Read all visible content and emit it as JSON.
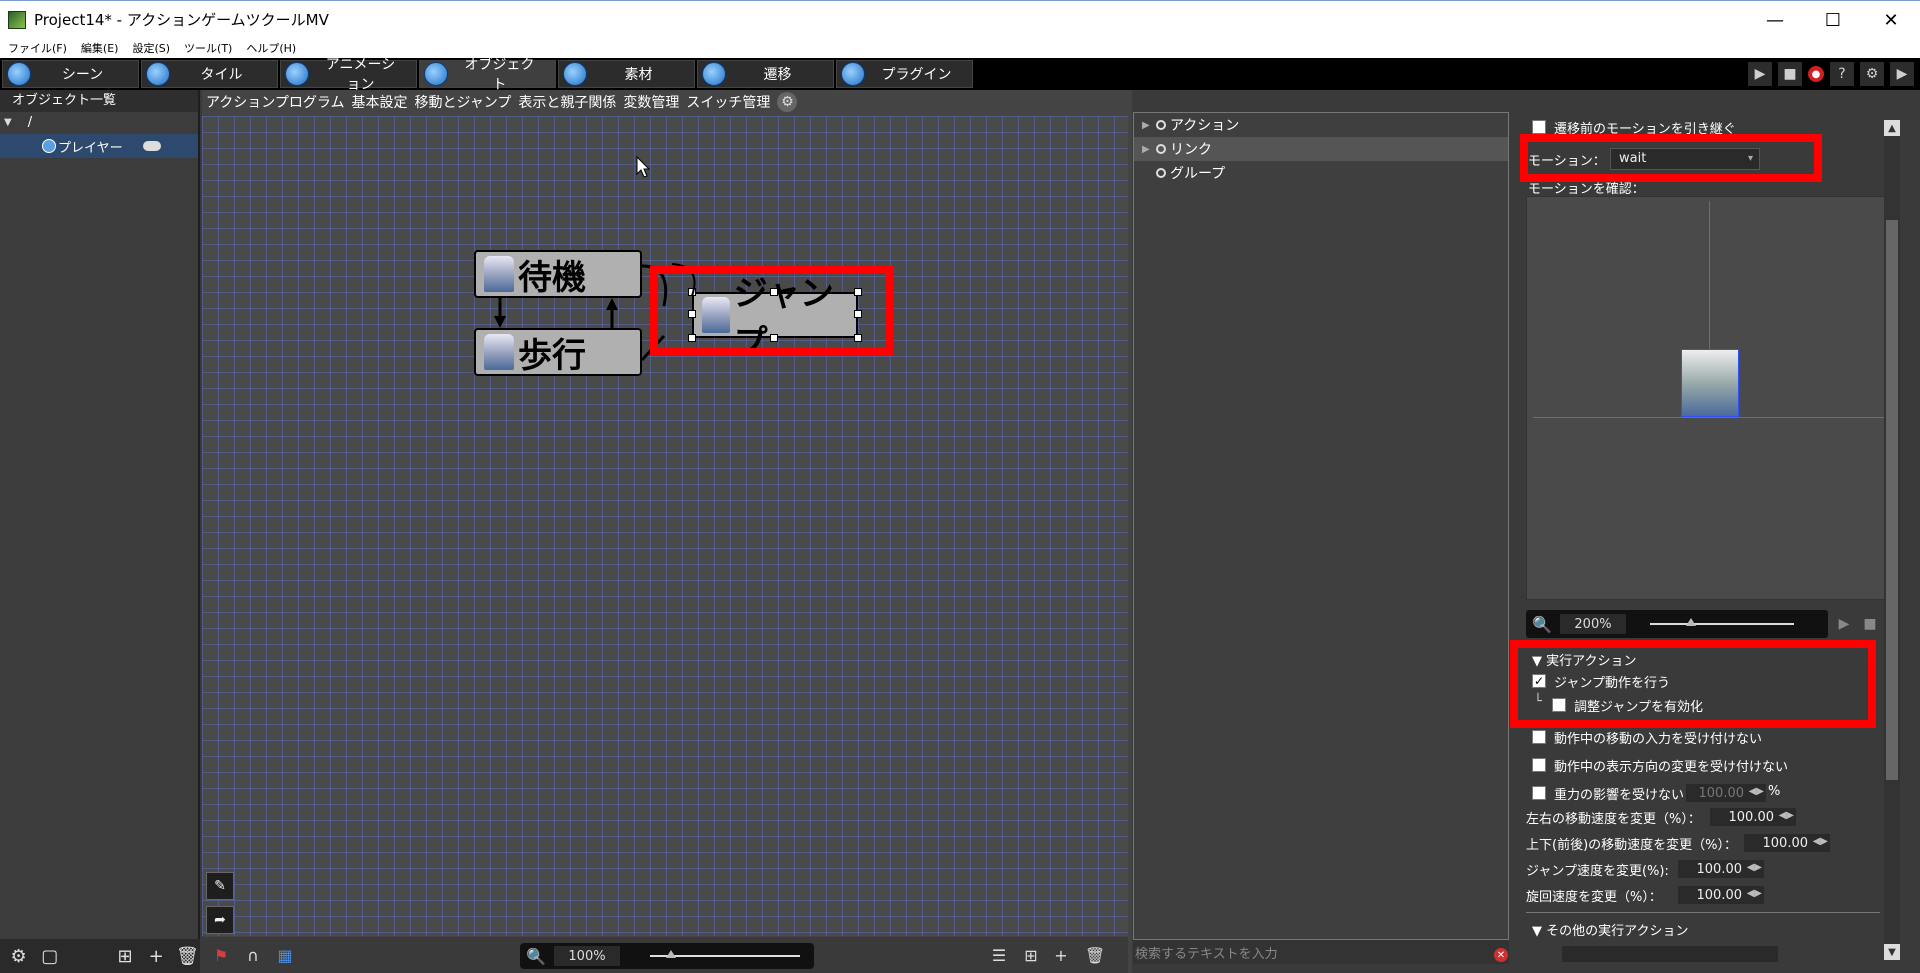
{
  "window": {
    "title": "Project14* - アクションゲームツクールMV"
  },
  "menubar": [
    "ファイル(F)",
    "編集(E)",
    "設定(S)",
    "ツール(T)",
    "ヘルプ(H)"
  ],
  "maintabs": [
    "シーン",
    "タイル",
    "アニメーション",
    "オブジェクト",
    "素材",
    "遷移",
    "プラグイン"
  ],
  "leftpanel": {
    "header": "オブジェクト一覧",
    "root": "/",
    "item": "プレイヤー"
  },
  "subtabs": [
    "アクションプログラム",
    "基本設定",
    "移動とジャンプ",
    "表示と親子関係",
    "変数管理",
    "スイッチ管理"
  ],
  "states": {
    "wait": "待機",
    "walk": "歩行",
    "jump": "ジャンプ"
  },
  "canvas": {
    "zoom": "100%"
  },
  "actions": [
    "アクション",
    "リンク",
    "グループ"
  ],
  "search": {
    "placeholder": "検索するテキストを入力"
  },
  "props": {
    "inherit_motion": "遷移前のモーションを引き継ぐ",
    "motion_label": "モーション：",
    "motion_value": "wait",
    "confirm_motion": "モーションを確認：",
    "preview_zoom": "200%",
    "exec_action": "実行アクション",
    "jump_do": "ジャンプ動作を行う",
    "jump_do_checked": true,
    "adjust_jump": "調整ジャンプを有効化",
    "adjust_jump_checked": false,
    "no_move_input": "動作中の移動の入力を受け付けない",
    "no_dir_change": "動作中の表示方向の変更を受け付けない",
    "no_gravity": "重力の影響を受けない",
    "gravity_value": "100.00",
    "gravity_unit": "%",
    "lr_speed_label": "左右の移動速度を変更（%）：",
    "lr_speed": "100.00",
    "ud_speed_label": "上下(前後)の移動速度を変更（%）：",
    "ud_speed": "100.00",
    "jump_speed_label": "ジャンプ速度を変更(%):",
    "jump_speed": "100.00",
    "rot_speed_label": "旋回速度を変更（%）：",
    "rot_speed": "100.00",
    "other_actions": "その他の実行アクション"
  },
  "colors": {
    "highlight": "#ff0000",
    "grid": "#5a6ebe"
  }
}
